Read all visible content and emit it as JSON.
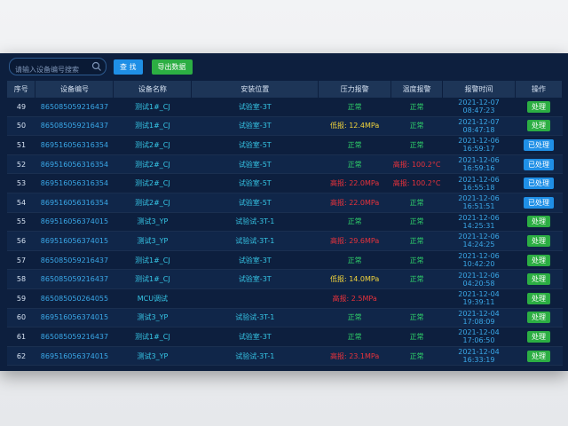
{
  "toolbar": {
    "search_placeholder": "请输入设备编号搜索",
    "search_button": "查 找",
    "export_button": "导出数据"
  },
  "table": {
    "headers": [
      "序号",
      "设备编号",
      "设备名称",
      "安装位置",
      "压力报警",
      "温度报警",
      "报警时间",
      "操作"
    ],
    "rows": [
      {
        "id": "49",
        "device": "865085059216437",
        "name": "测试1#_CJ",
        "location": "试验室-3T",
        "pressure": "正常",
        "pressure_status": "ok",
        "temp": "正常",
        "temp_status": "ok",
        "time": "2021-12-07 08:47:23",
        "action": "处理",
        "action_style": "green"
      },
      {
        "id": "50",
        "device": "865085059216437",
        "name": "测试1#_CJ",
        "location": "试验室-3T",
        "pressure": "低报: 12.4MPa",
        "pressure_status": "low",
        "temp": "正常",
        "temp_status": "ok",
        "time": "2021-12-07 08:47:18",
        "action": "处理",
        "action_style": "green"
      },
      {
        "id": "51",
        "device": "869516056316354",
        "name": "测试2#_CJ",
        "location": "试验室-5T",
        "pressure": "正常",
        "pressure_status": "ok",
        "temp": "正常",
        "temp_status": "ok",
        "time": "2021-12-06 16:59:17",
        "action": "已处理",
        "action_style": "blue"
      },
      {
        "id": "52",
        "device": "869516056316354",
        "name": "测试2#_CJ",
        "location": "试验室-5T",
        "pressure": "正常",
        "pressure_status": "ok",
        "temp": "高报: 100.2°C",
        "temp_status": "high",
        "time": "2021-12-06 16:59:16",
        "action": "已处理",
        "action_style": "blue"
      },
      {
        "id": "53",
        "device": "869516056316354",
        "name": "测试2#_CJ",
        "location": "试验室-5T",
        "pressure": "高报: 22.0MPa",
        "pressure_status": "high",
        "temp": "高报: 100.2°C",
        "temp_status": "high",
        "time": "2021-12-06 16:55:18",
        "action": "已处理",
        "action_style": "blue"
      },
      {
        "id": "54",
        "device": "869516056316354",
        "name": "测试2#_CJ",
        "location": "试验室-5T",
        "pressure": "高报: 22.0MPa",
        "pressure_status": "high",
        "temp": "正常",
        "temp_status": "ok",
        "time": "2021-12-06 16:51:51",
        "action": "已处理",
        "action_style": "blue"
      },
      {
        "id": "55",
        "device": "869516056374015",
        "name": "测试3_YP",
        "location": "试验试-3T-1",
        "pressure": "正常",
        "pressure_status": "ok",
        "temp": "正常",
        "temp_status": "ok",
        "time": "2021-12-06 14:25:31",
        "action": "处理",
        "action_style": "green"
      },
      {
        "id": "56",
        "device": "869516056374015",
        "name": "测试3_YP",
        "location": "试验试-3T-1",
        "pressure": "高报: 29.6MPa",
        "pressure_status": "high",
        "temp": "正常",
        "temp_status": "ok",
        "time": "2021-12-06 14:24:25",
        "action": "处理",
        "action_style": "green"
      },
      {
        "id": "57",
        "device": "865085059216437",
        "name": "测试1#_CJ",
        "location": "试验室-3T",
        "pressure": "正常",
        "pressure_status": "ok",
        "temp": "正常",
        "temp_status": "ok",
        "time": "2021-12-06 10:42:20",
        "action": "处理",
        "action_style": "green"
      },
      {
        "id": "58",
        "device": "865085059216437",
        "name": "测试1#_CJ",
        "location": "试验室-3T",
        "pressure": "低报: 14.0MPa",
        "pressure_status": "low",
        "temp": "正常",
        "temp_status": "ok",
        "time": "2021-12-06 04:20:58",
        "action": "处理",
        "action_style": "green"
      },
      {
        "id": "59",
        "device": "865085050264055",
        "name": "MCU调试",
        "location": "",
        "pressure": "高报: 2.5MPa",
        "pressure_status": "high",
        "temp": "",
        "temp_status": "ok",
        "time": "2021-12-04 19:39:11",
        "action": "处理",
        "action_style": "green"
      },
      {
        "id": "60",
        "device": "869516056374015",
        "name": "测试3_YP",
        "location": "试验试-3T-1",
        "pressure": "正常",
        "pressure_status": "ok",
        "temp": "正常",
        "temp_status": "ok",
        "time": "2021-12-04 17:08:09",
        "action": "处理",
        "action_style": "green"
      },
      {
        "id": "61",
        "device": "865085059216437",
        "name": "测试1#_CJ",
        "location": "试验室-3T",
        "pressure": "正常",
        "pressure_status": "ok",
        "temp": "正常",
        "temp_status": "ok",
        "time": "2021-12-04 17:06:50",
        "action": "处理",
        "action_style": "green"
      },
      {
        "id": "62",
        "device": "869516056374015",
        "name": "测试3_YP",
        "location": "试验试-3T-1",
        "pressure": "高报: 23.1MPa",
        "pressure_status": "high",
        "temp": "正常",
        "temp_status": "ok",
        "time": "2021-12-04 16:33:19",
        "action": "处理",
        "action_style": "green"
      }
    ]
  },
  "colors": {
    "panel_bg": "#0d1f3e",
    "ok": "#2fd36b",
    "low_alarm": "#f2d43b",
    "high_alarm": "#e8323b",
    "action_green": "#2cae43",
    "action_blue": "#1f8fe6"
  }
}
